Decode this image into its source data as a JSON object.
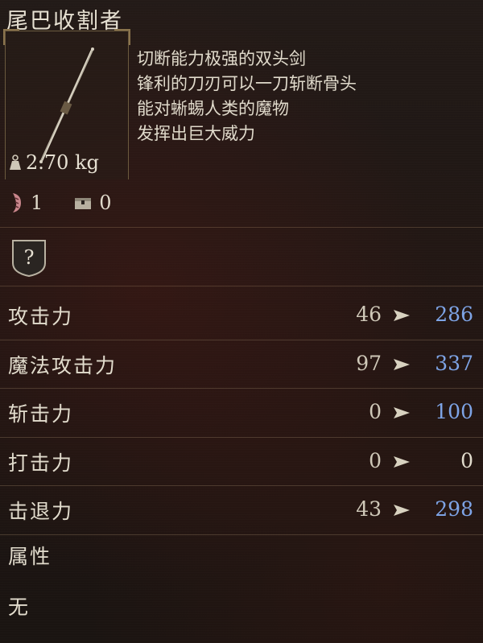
{
  "item": {
    "name": "尾巴收割者",
    "weight": "2.70 kg",
    "description": [
      "切断能力极强的双头剑",
      "锋利的刀刃可以一刀斩断骨头",
      "能对蜥蜴人类的魔物",
      "发挥出巨大威力"
    ],
    "owned_count": "1",
    "stored_count": "0",
    "icons": {
      "weight": "weight-icon",
      "owned": "owned-claw-icon",
      "stored": "storage-chest-icon",
      "unknown": "unknown-question-icon",
      "compare_arrow": "arrow-right-icon"
    }
  },
  "stats": [
    {
      "label": "攻击力",
      "current": "46",
      "new": "286",
      "trend": "up"
    },
    {
      "label": "魔法攻击力",
      "current": "97",
      "new": "337",
      "trend": "up"
    },
    {
      "label": "斩击力",
      "current": "0",
      "new": "100",
      "trend": "up"
    },
    {
      "label": "打击力",
      "current": "0",
      "new": "0",
      "trend": "same"
    },
    {
      "label": "击退力",
      "current": "43",
      "new": "298",
      "trend": "up"
    }
  ],
  "attribute": {
    "label": "属性",
    "value": "无"
  },
  "colors": {
    "increase": "#7ea4e6",
    "neutral": "#e2dccd",
    "frame": "#8a744d"
  }
}
